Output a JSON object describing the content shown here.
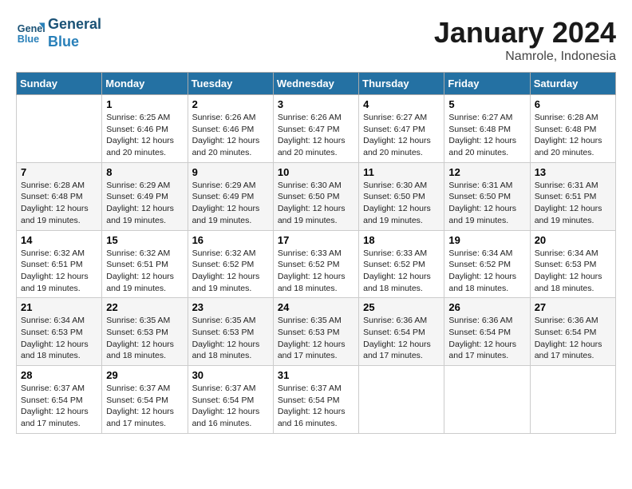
{
  "header": {
    "logo_line1": "General",
    "logo_line2": "Blue",
    "month_title": "January 2024",
    "location": "Namrole, Indonesia"
  },
  "days_of_week": [
    "Sunday",
    "Monday",
    "Tuesday",
    "Wednesday",
    "Thursday",
    "Friday",
    "Saturday"
  ],
  "weeks": [
    [
      {
        "day": "",
        "info": ""
      },
      {
        "day": "1",
        "info": "Sunrise: 6:25 AM\nSunset: 6:46 PM\nDaylight: 12 hours and 20 minutes."
      },
      {
        "day": "2",
        "info": "Sunrise: 6:26 AM\nSunset: 6:46 PM\nDaylight: 12 hours and 20 minutes."
      },
      {
        "day": "3",
        "info": "Sunrise: 6:26 AM\nSunset: 6:47 PM\nDaylight: 12 hours and 20 minutes."
      },
      {
        "day": "4",
        "info": "Sunrise: 6:27 AM\nSunset: 6:47 PM\nDaylight: 12 hours and 20 minutes."
      },
      {
        "day": "5",
        "info": "Sunrise: 6:27 AM\nSunset: 6:48 PM\nDaylight: 12 hours and 20 minutes."
      },
      {
        "day": "6",
        "info": "Sunrise: 6:28 AM\nSunset: 6:48 PM\nDaylight: 12 hours and 20 minutes."
      }
    ],
    [
      {
        "day": "7",
        "info": "Sunrise: 6:28 AM\nSunset: 6:48 PM\nDaylight: 12 hours and 19 minutes."
      },
      {
        "day": "8",
        "info": "Sunrise: 6:29 AM\nSunset: 6:49 PM\nDaylight: 12 hours and 19 minutes."
      },
      {
        "day": "9",
        "info": "Sunrise: 6:29 AM\nSunset: 6:49 PM\nDaylight: 12 hours and 19 minutes."
      },
      {
        "day": "10",
        "info": "Sunrise: 6:30 AM\nSunset: 6:50 PM\nDaylight: 12 hours and 19 minutes."
      },
      {
        "day": "11",
        "info": "Sunrise: 6:30 AM\nSunset: 6:50 PM\nDaylight: 12 hours and 19 minutes."
      },
      {
        "day": "12",
        "info": "Sunrise: 6:31 AM\nSunset: 6:50 PM\nDaylight: 12 hours and 19 minutes."
      },
      {
        "day": "13",
        "info": "Sunrise: 6:31 AM\nSunset: 6:51 PM\nDaylight: 12 hours and 19 minutes."
      }
    ],
    [
      {
        "day": "14",
        "info": "Sunrise: 6:32 AM\nSunset: 6:51 PM\nDaylight: 12 hours and 19 minutes."
      },
      {
        "day": "15",
        "info": "Sunrise: 6:32 AM\nSunset: 6:51 PM\nDaylight: 12 hours and 19 minutes."
      },
      {
        "day": "16",
        "info": "Sunrise: 6:32 AM\nSunset: 6:52 PM\nDaylight: 12 hours and 19 minutes."
      },
      {
        "day": "17",
        "info": "Sunrise: 6:33 AM\nSunset: 6:52 PM\nDaylight: 12 hours and 18 minutes."
      },
      {
        "day": "18",
        "info": "Sunrise: 6:33 AM\nSunset: 6:52 PM\nDaylight: 12 hours and 18 minutes."
      },
      {
        "day": "19",
        "info": "Sunrise: 6:34 AM\nSunset: 6:52 PM\nDaylight: 12 hours and 18 minutes."
      },
      {
        "day": "20",
        "info": "Sunrise: 6:34 AM\nSunset: 6:53 PM\nDaylight: 12 hours and 18 minutes."
      }
    ],
    [
      {
        "day": "21",
        "info": "Sunrise: 6:34 AM\nSunset: 6:53 PM\nDaylight: 12 hours and 18 minutes."
      },
      {
        "day": "22",
        "info": "Sunrise: 6:35 AM\nSunset: 6:53 PM\nDaylight: 12 hours and 18 minutes."
      },
      {
        "day": "23",
        "info": "Sunrise: 6:35 AM\nSunset: 6:53 PM\nDaylight: 12 hours and 18 minutes."
      },
      {
        "day": "24",
        "info": "Sunrise: 6:35 AM\nSunset: 6:53 PM\nDaylight: 12 hours and 17 minutes."
      },
      {
        "day": "25",
        "info": "Sunrise: 6:36 AM\nSunset: 6:54 PM\nDaylight: 12 hours and 17 minutes."
      },
      {
        "day": "26",
        "info": "Sunrise: 6:36 AM\nSunset: 6:54 PM\nDaylight: 12 hours and 17 minutes."
      },
      {
        "day": "27",
        "info": "Sunrise: 6:36 AM\nSunset: 6:54 PM\nDaylight: 12 hours and 17 minutes."
      }
    ],
    [
      {
        "day": "28",
        "info": "Sunrise: 6:37 AM\nSunset: 6:54 PM\nDaylight: 12 hours and 17 minutes."
      },
      {
        "day": "29",
        "info": "Sunrise: 6:37 AM\nSunset: 6:54 PM\nDaylight: 12 hours and 17 minutes."
      },
      {
        "day": "30",
        "info": "Sunrise: 6:37 AM\nSunset: 6:54 PM\nDaylight: 12 hours and 16 minutes."
      },
      {
        "day": "31",
        "info": "Sunrise: 6:37 AM\nSunset: 6:54 PM\nDaylight: 12 hours and 16 minutes."
      },
      {
        "day": "",
        "info": ""
      },
      {
        "day": "",
        "info": ""
      },
      {
        "day": "",
        "info": ""
      }
    ]
  ]
}
